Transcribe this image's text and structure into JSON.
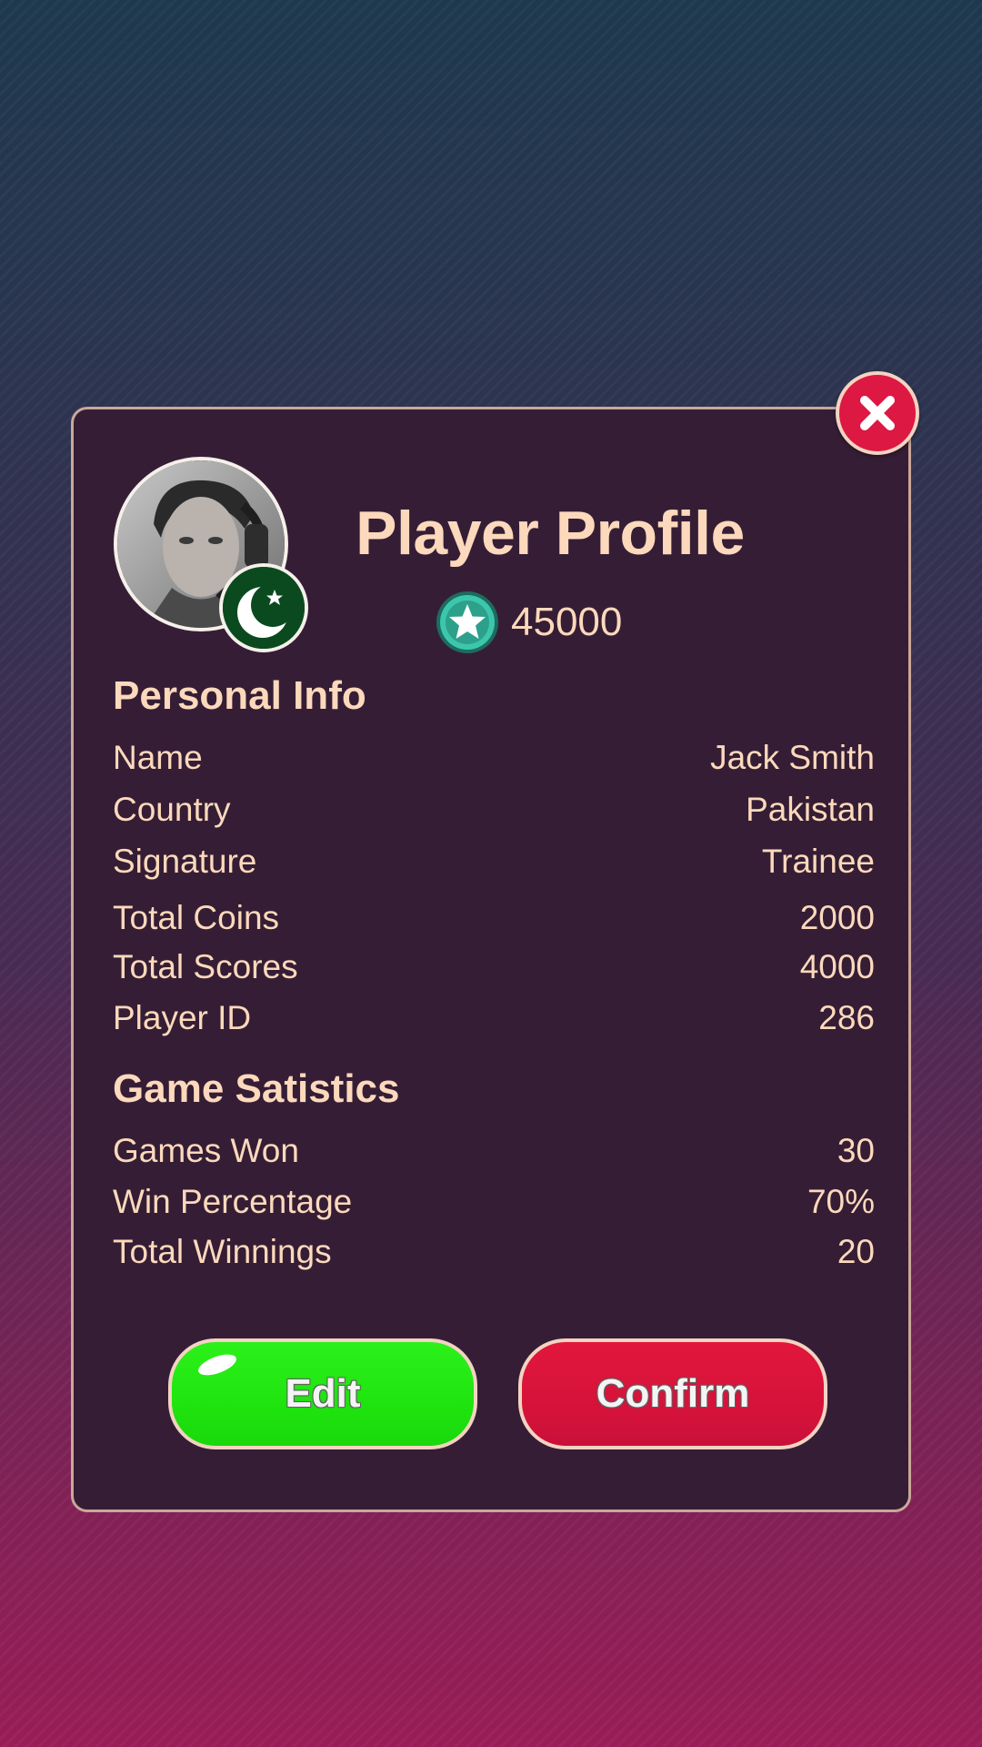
{
  "dialog": {
    "title": "Player Profile",
    "score": "45000",
    "flag_country": "Pakistan"
  },
  "personal_info": {
    "heading": "Personal Info",
    "rows": [
      {
        "label": "Name",
        "value": "Jack Smith"
      },
      {
        "label": "Country",
        "value": "Pakistan"
      },
      {
        "label": "Signature",
        "value": "Trainee"
      },
      {
        "label": "Total Coins",
        "value": "2000"
      },
      {
        "label": "Total Scores",
        "value": "4000"
      },
      {
        "label": "Player ID",
        "value": "286"
      }
    ]
  },
  "game_statistics": {
    "heading": "Game Satistics",
    "rows": [
      {
        "label": "Games Won",
        "value": "30"
      },
      {
        "label": "Win Percentage",
        "value": "70%"
      },
      {
        "label": "Total Winnings",
        "value": "20"
      }
    ]
  },
  "buttons": {
    "edit_label": "Edit",
    "confirm_label": "Confirm"
  },
  "icons": {
    "close": "close-icon",
    "score": "star-coin-icon",
    "flag": "crescent-star-icon"
  },
  "colors": {
    "panel_bg": "#351e35",
    "text": "#fcd9bc",
    "close_red": "#dc1843",
    "edit_green": "#1fe40f",
    "confirm_red": "#d4123a",
    "score_teal": "#3cc7ad"
  }
}
